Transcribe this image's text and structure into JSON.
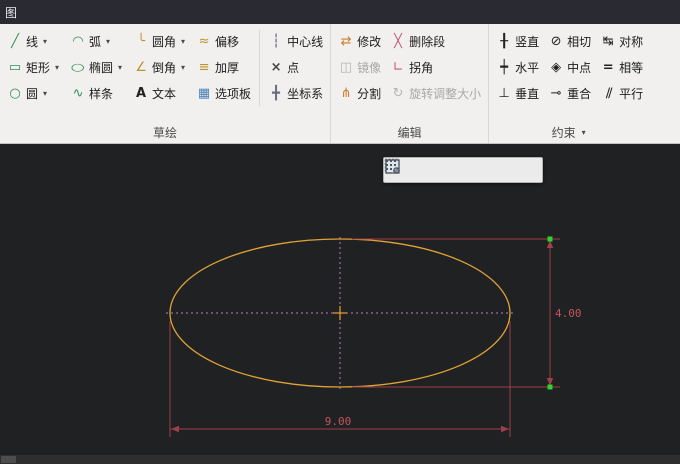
{
  "window": {
    "top_bar_text": "图"
  },
  "ribbon": {
    "sketch": {
      "label": "草绘",
      "items": [
        {
          "label": "线",
          "icon": "line-icon",
          "dropdown": true
        },
        {
          "label": "矩形",
          "icon": "rectangle-icon",
          "dropdown": true
        },
        {
          "label": "圆",
          "icon": "circle-icon",
          "dropdown": true
        },
        {
          "label": "弧",
          "icon": "arc-icon",
          "dropdown": true
        },
        {
          "label": "椭圆",
          "icon": "ellipse-icon",
          "dropdown": true
        },
        {
          "label": "样条",
          "icon": "spline-icon",
          "dropdown": false
        },
        {
          "label": "圆角",
          "icon": "fillet-icon",
          "dropdown": true
        },
        {
          "label": "倒角",
          "icon": "chamfer-icon",
          "dropdown": true
        },
        {
          "label": "文本",
          "icon": "text-icon",
          "dropdown": false
        },
        {
          "label": "偏移",
          "icon": "offset-icon",
          "dropdown": false
        },
        {
          "label": "加厚",
          "icon": "thicken-icon",
          "dropdown": false
        },
        {
          "label": "选项板",
          "icon": "palette-icon",
          "dropdown": false
        },
        {
          "label": "中心线",
          "icon": "centerline-icon",
          "dropdown": false
        },
        {
          "label": "点",
          "icon": "point-icon",
          "dropdown": false
        },
        {
          "label": "坐标系",
          "icon": "csys-icon",
          "dropdown": false
        }
      ]
    },
    "edit": {
      "label": "编辑",
      "items": [
        {
          "label": "修改",
          "icon": "modify-icon",
          "disabled": false
        },
        {
          "label": "镜像",
          "icon": "mirror-icon",
          "disabled": true
        },
        {
          "label": "分割",
          "icon": "divide-icon",
          "disabled": false
        },
        {
          "label": "删除段",
          "icon": "delete-segment-icon",
          "disabled": false
        },
        {
          "label": "拐角",
          "icon": "corner-icon",
          "disabled": false
        },
        {
          "label": "旋转调整大小",
          "icon": "rotate-resize-icon",
          "disabled": true
        }
      ]
    },
    "constrain": {
      "label": "约束",
      "items": [
        {
          "label": "竖直",
          "icon": "vertical-icon"
        },
        {
          "label": "水平",
          "icon": "horizontal-icon"
        },
        {
          "label": "垂直",
          "icon": "perpendicular-icon"
        },
        {
          "label": "相切",
          "icon": "tangent-icon"
        },
        {
          "label": "中点",
          "icon": "midpoint-icon"
        },
        {
          "label": "重合",
          "icon": "coincident-icon"
        },
        {
          "label": "对称",
          "icon": "symmetric-icon"
        },
        {
          "label": "相等",
          "icon": "equal-icon"
        },
        {
          "label": "平行",
          "icon": "parallel-icon"
        }
      ]
    }
  },
  "canvas": {
    "view_toolbar_icons": [
      "zoom-refit",
      "zoom-in",
      "zoom-out",
      "display-style",
      "display-style-alt",
      "grid-settings"
    ],
    "entity": "ellipse",
    "dimensions": {
      "width_label": "9.00",
      "height_label": "4.00"
    },
    "colors": {
      "entity": "#dfa238",
      "centerline": "#c478c4",
      "dimension": "#9c4049",
      "handle": "#2fd42f",
      "background": "#202122"
    }
  }
}
